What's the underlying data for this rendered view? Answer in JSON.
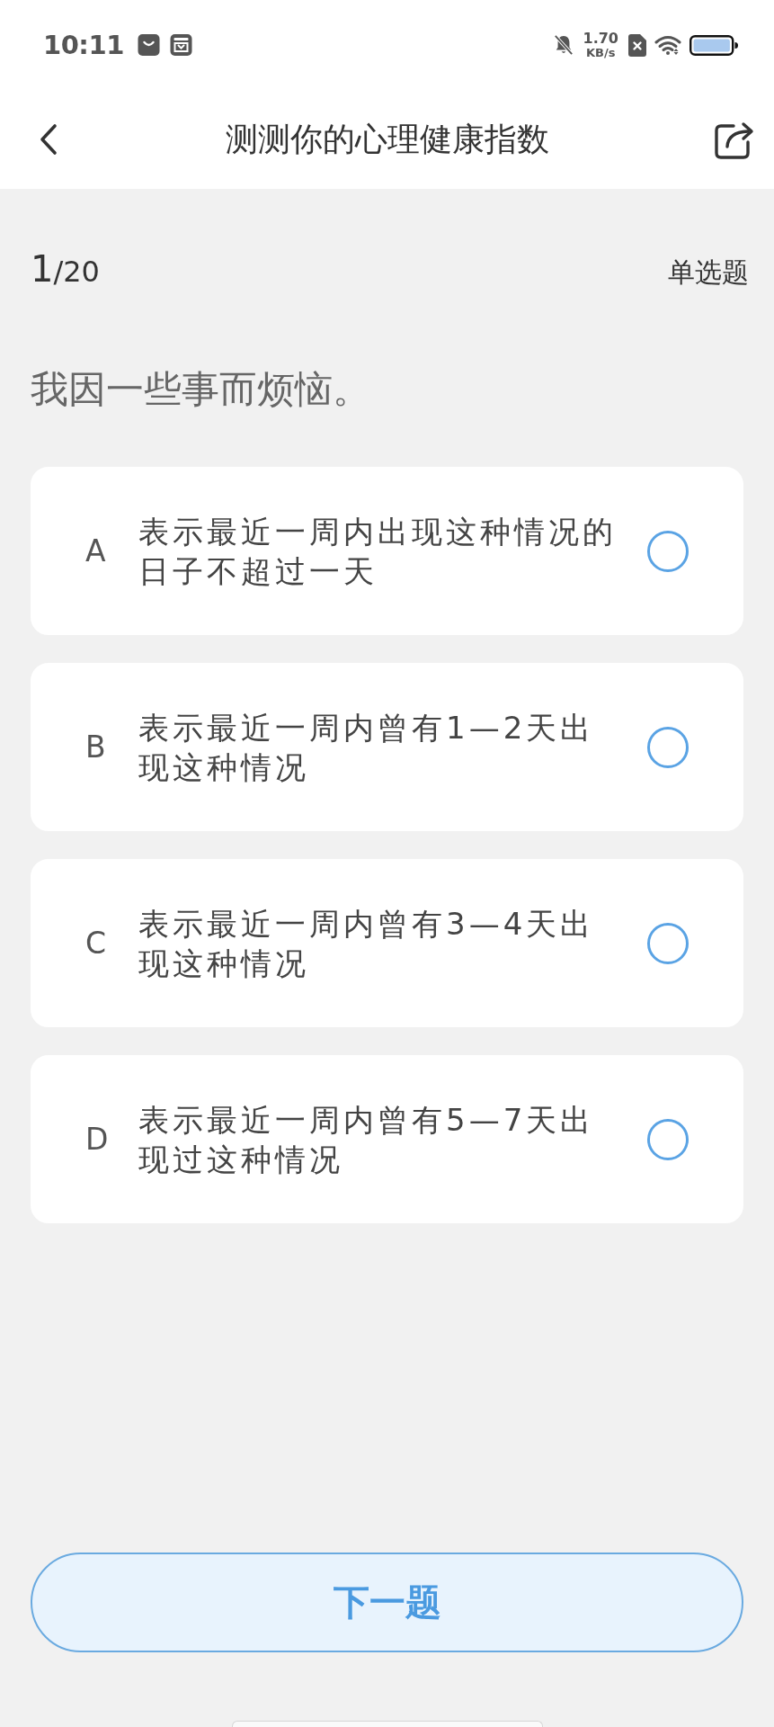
{
  "status_bar": {
    "time": "10:11",
    "net_speed_value": "1.70",
    "net_speed_unit": "KB/s"
  },
  "header": {
    "title": "测测你的心理健康指数"
  },
  "progress": {
    "current": "1",
    "total_suffix": "/20",
    "question_type": "单选题"
  },
  "question": "我因一些事而烦恼。",
  "options": [
    {
      "letter": "A",
      "text": "表示最近一周内出现这种情况的日子不超过一天",
      "selected": false
    },
    {
      "letter": "B",
      "text": "表示最近一周内曾有1—2天出现这种情况",
      "selected": false
    },
    {
      "letter": "C",
      "text": "表示最近一周内曾有3—4天出现这种情况",
      "selected": false
    },
    {
      "letter": "D",
      "text": "表示最近一周内曾有5—7天出现过这种情况",
      "selected": false
    }
  ],
  "next_button": {
    "label": "下一题"
  }
}
